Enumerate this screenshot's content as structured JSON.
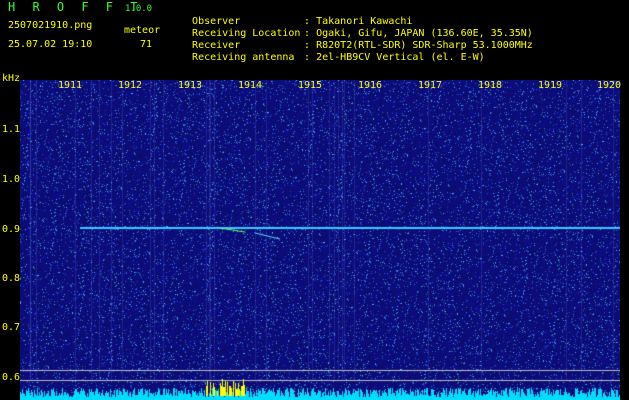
{
  "header": {
    "logo": "H R O F F T",
    "version": "1.0.0",
    "filename": "2507021910.png",
    "datetime": "25.07.02 19:10",
    "meteor_label": "meteor",
    "meteor_count": "71"
  },
  "info": [
    {
      "key": "Observer",
      "value": ": Takanori Kawachi"
    },
    {
      "key": "Receiving Location",
      "value": ": Ogaki, Gifu, JAPAN (136.60E, 35.35N)"
    },
    {
      "key": "Receiver",
      "value": ": R820T2(RTL-SDR) SDR-Sharp 53.1000MHz"
    },
    {
      "key": "Receiving antenna",
      "value": ": 2el-HB9CV Vertical (el. E-W)"
    }
  ],
  "axis": {
    "y_unit": "kHz",
    "y_ticks": [
      "1.1",
      "1.0",
      "0.9",
      "0.8",
      "0.7",
      "0.6"
    ],
    "x_ticks": [
      "1911",
      "1912",
      "1913",
      "1914",
      "1915",
      "1916",
      "1917",
      "1918",
      "1919",
      "1920"
    ]
  },
  "colors": {
    "background": "#000000",
    "spectrogram": "#1a1a8c",
    "signal": "#33ccff",
    "text": "#ffff00",
    "logo": "#33ff33"
  }
}
